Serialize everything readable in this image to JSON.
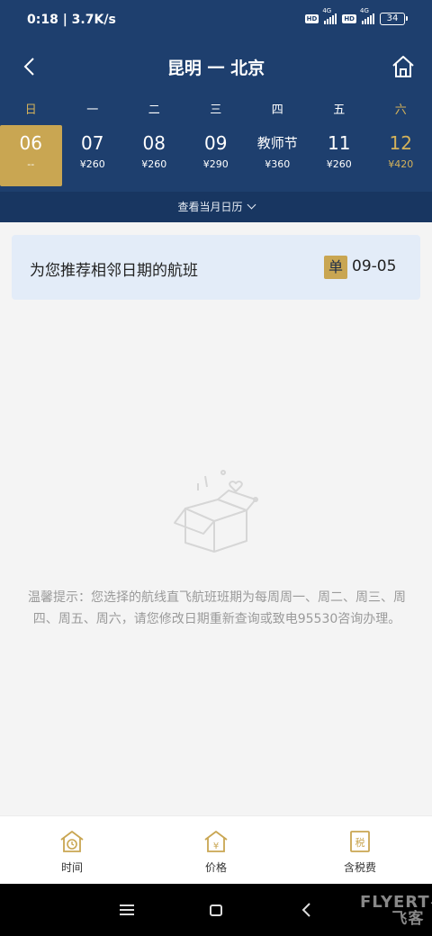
{
  "status_bar": {
    "time_speed": "0:18 | 3.7K/s",
    "hd1": "HD",
    "net1": "4G",
    "hd2": "HD",
    "net2": "4G",
    "battery": "34"
  },
  "header": {
    "route": "昆明 一 北京",
    "back_icon": "chevron-left-icon",
    "home_icon": "home-icon"
  },
  "week_days": [
    "日",
    "一",
    "二",
    "三",
    "四",
    "五",
    "六"
  ],
  "dates": [
    {
      "day": "06",
      "price": "--",
      "selected": true
    },
    {
      "day": "07",
      "price": "¥260"
    },
    {
      "day": "08",
      "price": "¥260"
    },
    {
      "day": "09",
      "price": "¥290"
    },
    {
      "day": "教师节",
      "price": "¥360"
    },
    {
      "day": "11",
      "price": "¥260"
    },
    {
      "day": "12",
      "price": "¥420"
    }
  ],
  "calendar_toggle": "查看当月日历",
  "recommend": {
    "text": "为您推荐相邻日期的航班",
    "badge": "单",
    "date": "09-05"
  },
  "empty_state": {
    "icon": "empty-box-icon",
    "tip": "温馨提示：您选择的航线直飞航班班期为每周周一、周二、周三、周四、周五、周六，请您修改日期重新查询或致电95530咨询办理。"
  },
  "bottom_tabs": [
    {
      "label": "时间",
      "icon": "clock-house-icon"
    },
    {
      "label": "价格",
      "icon": "price-house-icon"
    },
    {
      "label": "含税费",
      "icon": "tax-receipt-icon"
    }
  ],
  "watermark": {
    "brand": "FLYERT",
    "sub": "飞客"
  },
  "colors": {
    "header_bg": "#1e3f6e",
    "accent_gold": "#c9a652",
    "card_bg": "#e3ecf8"
  }
}
